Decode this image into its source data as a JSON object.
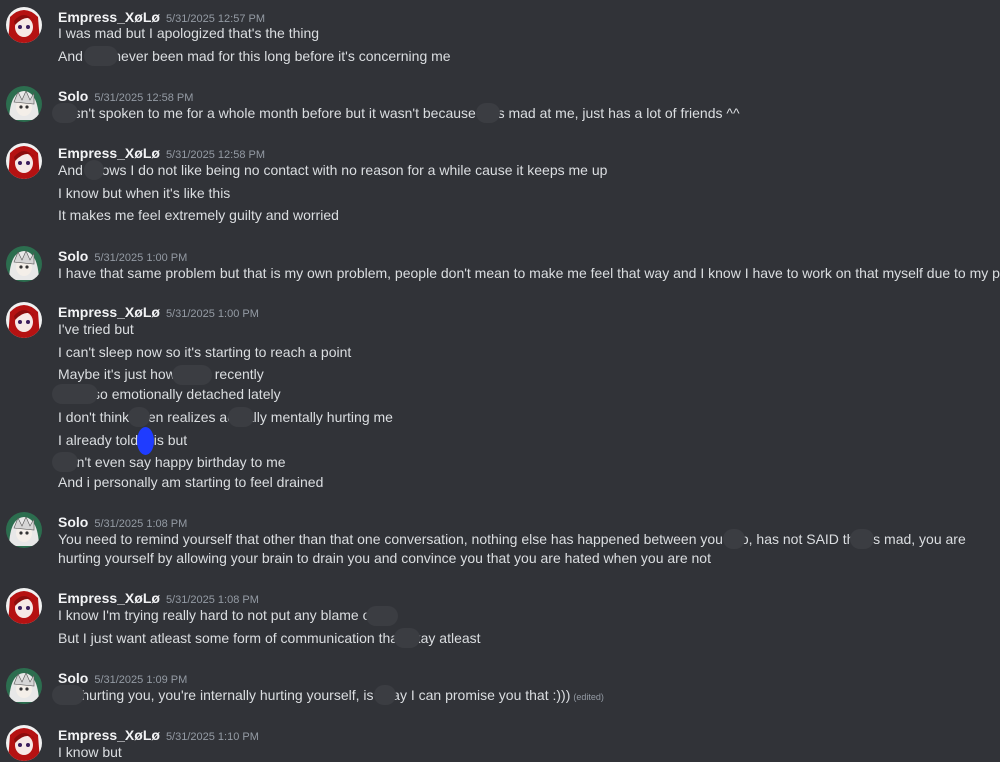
{
  "users": {
    "empress": {
      "name": "Empress_XøLø"
    },
    "solo": {
      "name": "Solo"
    }
  },
  "messages": [
    {
      "user": "Empress_XøLø",
      "time": "5/31/2025 12:57 PM",
      "lines": [
        "I was mad but I apologized that's the thing",
        "And        has never been mad for this long before it's concerning me"
      ]
    },
    {
      "user": "Solo",
      "time": "5/31/2025 12:58 PM",
      "lines": [
        "      hasn't spoken to me for a whole month before but it wasn't because      was mad at me, just has a lot of friends ^^"
      ]
    },
    {
      "user": "Empress_XøLø",
      "time": "5/31/2025 12:58 PM",
      "lines": [
        "And      knows I do not like being no contact with no reason for a while cause it keeps me up",
        "I know but when it's like this",
        "It makes me feel extremely guilty and worried"
      ]
    },
    {
      "user": "Solo",
      "time": "5/31/2025 1:00 PM",
      "lines": [
        "I have that same problem but that is my own problem, people don't mean to make me feel that way and I know I have to work on that myself due to my past ^^"
      ]
    },
    {
      "user": "Empress_XøLø",
      "time": "5/31/2025 1:00 PM",
      "lines": [
        "I've tried but",
        "I can't sleep now so it's starting to reach a point",
        "Maybe it's just how          been recently",
        "      been so emotionally detached lately",
        "I don't think       even realizes       actually mentally hurting me",
        "I already told      this but",
        "      didn't even say happy birthday to me",
        "And i personally am starting to feel drained"
      ]
    },
    {
      "user": "Solo",
      "time": "5/31/2025 1:08 PM",
      "lines": [
        "You need to remind yourself that other than that one conversation, nothing else has happened between you two,      has not SAID that      is mad, you are hurting yourself by allowing your brain to drain you and convince you that you are hated when you are not"
      ]
    },
    {
      "user": "Empress_XøLø",
      "time": "5/31/2025 1:08 PM",
      "lines": [
        "I know I'm trying really hard to not put any blame on",
        "But I just want atleast some form of communication that       okay atleast"
      ]
    },
    {
      "user": "Solo",
      "time": "5/31/2025 1:09 PM",
      "lines": [
        "      not hurting you, you're internally hurting yourself,      is okay I can promise you that :)))"
      ],
      "edited": "(edited)"
    },
    {
      "user": "Empress_XøLø",
      "time": "5/31/2025 1:10 PM",
      "lines": [
        "I know but"
      ]
    }
  ],
  "colors": {
    "background": "#313338",
    "name": "#f2f3f5",
    "timestamp": "#949ba4",
    "text": "#dbdee1",
    "redaction": "#3b3d42",
    "blue_mark": "#1f3cff"
  },
  "avatars": {
    "empress": "red-hair-avatar-icon",
    "solo": "white-hair-avatar-icon"
  }
}
